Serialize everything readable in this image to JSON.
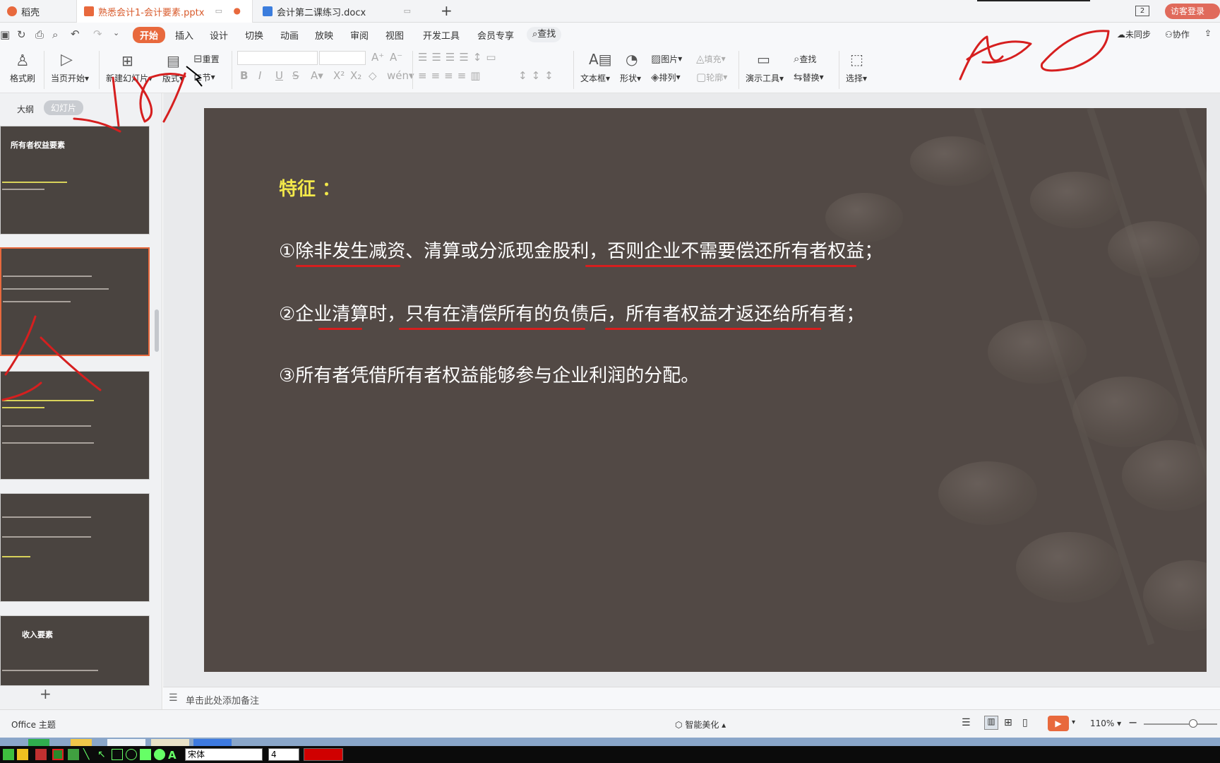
{
  "tabs": [
    {
      "label": "稻壳",
      "icon": "daoke-icon"
    },
    {
      "label": "熟悉会计1-会计要素.pptx",
      "icon": "ppt-file-icon"
    },
    {
      "label": "会计第二课练习.docx",
      "icon": "word-file-icon"
    }
  ],
  "window": {
    "page_count_badge": "2",
    "visitor_login": "访客登录"
  },
  "menu": {
    "items": [
      "开始",
      "插入",
      "设计",
      "切换",
      "动画",
      "放映",
      "审阅",
      "视图",
      "开发工具",
      "会员专享"
    ],
    "active": "开始",
    "search": "查找",
    "sync": "未同步",
    "collab": "协作"
  },
  "toolbar": {
    "format_painter": "格式刷",
    "from_current": "当页开始",
    "new_slide": "新建幻灯片",
    "layout": "版式",
    "reset": "重置",
    "section": "节",
    "text_box": "文本框",
    "shape": "形状",
    "picture": "图片",
    "arrange": "排列",
    "fill": "填充",
    "outline": "轮廓",
    "present_tool": "演示工具",
    "find": "查找",
    "replace": "替换",
    "select": "选择",
    "font_name": "",
    "font_size": ""
  },
  "left_panel": {
    "outline_tab": "大纲",
    "slides_tab": "幻灯片",
    "thumb_titles": [
      "所有者权益要素",
      "",
      "",
      "",
      "收入要素"
    ]
  },
  "slide": {
    "title": "特征 ：",
    "points": [
      "①除非发生减资、清算或分派现金股利，否则企业不需要偿还所有者权益；",
      "②企业清算时，只有在清偿所有的负债后，所有者权益才返还给所有者；",
      "③所有者凭借所有者权益能够参与企业利润的分配。"
    ]
  },
  "notes": {
    "placeholder": "单击此处添加备注"
  },
  "status": {
    "theme": "Office 主题",
    "beautify": "智能美化",
    "zoom": "110%"
  },
  "drawbar": {
    "font": "宋体",
    "size": "4"
  },
  "colors": {
    "accent": "#e8693d",
    "slide_bg": "#524945",
    "title": "#f2e84a",
    "ink": "#d61f1f"
  }
}
